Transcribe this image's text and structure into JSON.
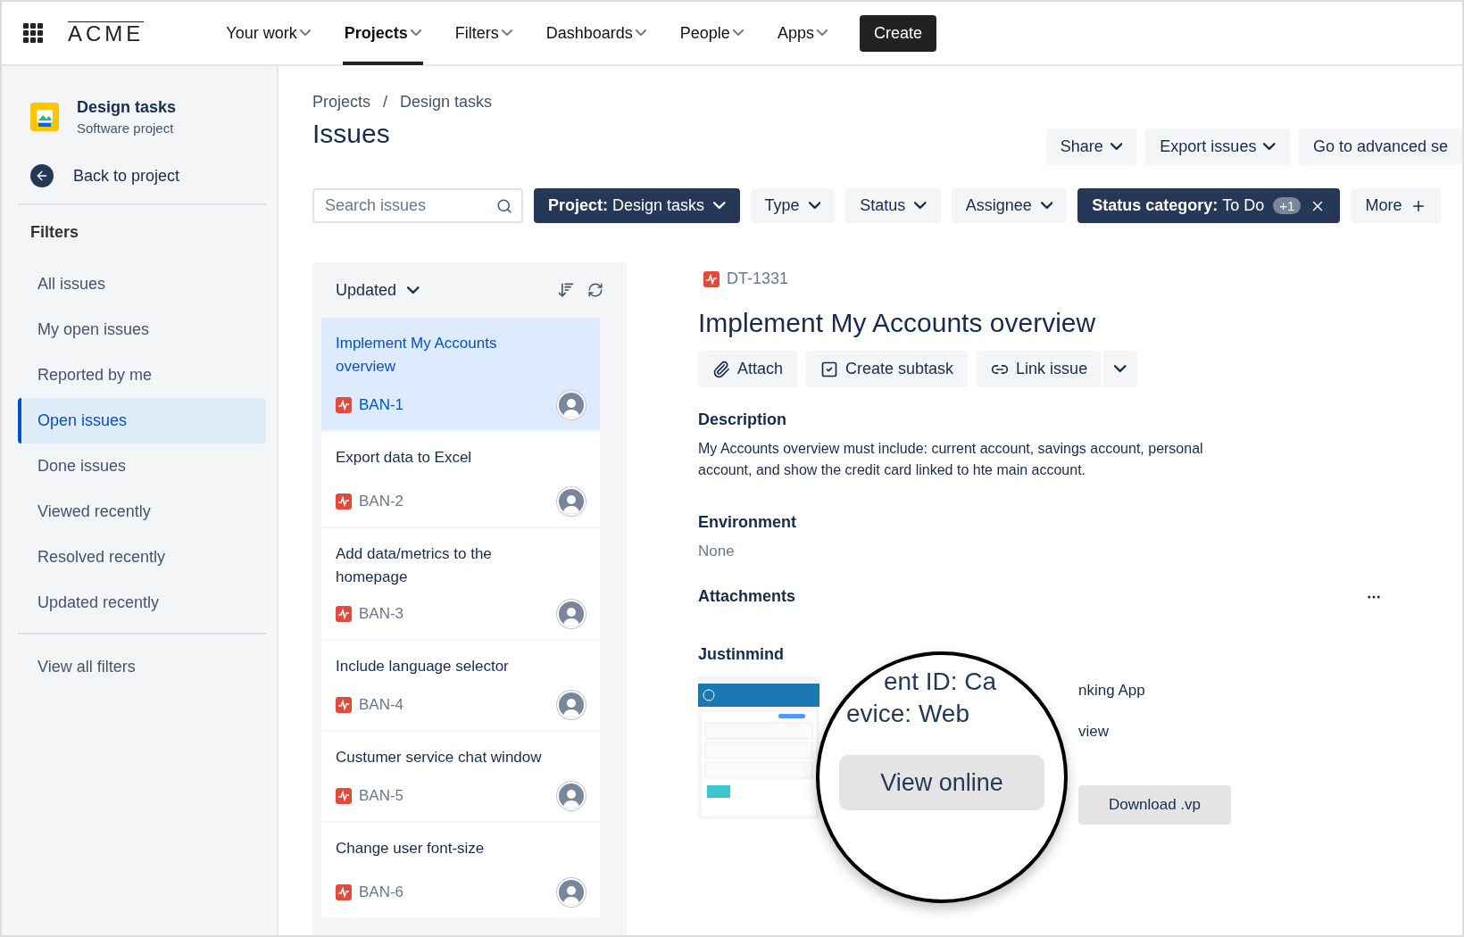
{
  "topbar": {
    "logo": "ACME",
    "nav": [
      {
        "label": "Your work",
        "selected": false
      },
      {
        "label": "Projects",
        "selected": true
      },
      {
        "label": "Filters",
        "selected": false
      },
      {
        "label": "Dashboards",
        "selected": false
      },
      {
        "label": "People",
        "selected": false
      },
      {
        "label": "Apps",
        "selected": false
      }
    ],
    "create": "Create"
  },
  "sidebar": {
    "project": {
      "name": "Design tasks",
      "type": "Software project"
    },
    "back": "Back to project",
    "heading": "Filters",
    "items": [
      {
        "label": "All issues",
        "selected": false
      },
      {
        "label": "My open issues",
        "selected": false
      },
      {
        "label": "Reported by me",
        "selected": false
      },
      {
        "label": "Open issues",
        "selected": true
      },
      {
        "label": "Done issues",
        "selected": false
      },
      {
        "label": "Viewed recently",
        "selected": false
      },
      {
        "label": "Resolved recently",
        "selected": false
      },
      {
        "label": "Updated recently",
        "selected": false
      }
    ],
    "view_all": "View all filters"
  },
  "header": {
    "breadcrumbs": [
      "Projects",
      "Design tasks"
    ],
    "separator": "/",
    "title": "Issues",
    "actions": [
      "Share",
      "Export issues",
      "Go to advanced se"
    ]
  },
  "filters": {
    "search": {
      "placeholder": "Search issues"
    },
    "chips": [
      {
        "kind": "applied",
        "label": "Project:",
        "value": "Design tasks"
      },
      {
        "kind": "plain",
        "value": "Type"
      },
      {
        "kind": "plain",
        "value": "Status"
      },
      {
        "kind": "plain",
        "value": "Assignee"
      },
      {
        "kind": "removable",
        "label": "Status category:",
        "value": "To Do",
        "badge": "+1"
      },
      {
        "kind": "more",
        "value": "More"
      }
    ]
  },
  "list": {
    "sort": "Updated",
    "issues": [
      {
        "title": "Implement My Accounts overview",
        "key": "BAN-1",
        "selected": true
      },
      {
        "title": "Export data to Excel",
        "key": "BAN-2",
        "selected": false
      },
      {
        "title": "Add data/metrics to the homepage",
        "key": "BAN-3",
        "selected": false
      },
      {
        "title": "Include language selector",
        "key": "BAN-4",
        "selected": false
      },
      {
        "title": "Custumer service chat window",
        "key": "BAN-5",
        "selected": false
      },
      {
        "title": "Change user font-size",
        "key": "BAN-6",
        "selected": false
      }
    ]
  },
  "detail": {
    "key": "DT-1331",
    "title": "Implement My Accounts overview",
    "actions": [
      "Attach",
      "Create subtask",
      "Link issue"
    ],
    "description": {
      "heading": "Description",
      "body": "My Accounts overview must include: current account, savings account, personal account, and show the credit card linked to hte main account."
    },
    "environment": {
      "heading": "Environment",
      "value": "None"
    },
    "attachments": {
      "heading": "Attachments",
      "name": "Justinmind",
      "lines": [
        "nking App",
        "view"
      ],
      "download": "Download .vp",
      "magnifier": {
        "lines": [
          "ent ID: Ca",
          "evice: Web"
        ],
        "button": "View online"
      }
    }
  }
}
